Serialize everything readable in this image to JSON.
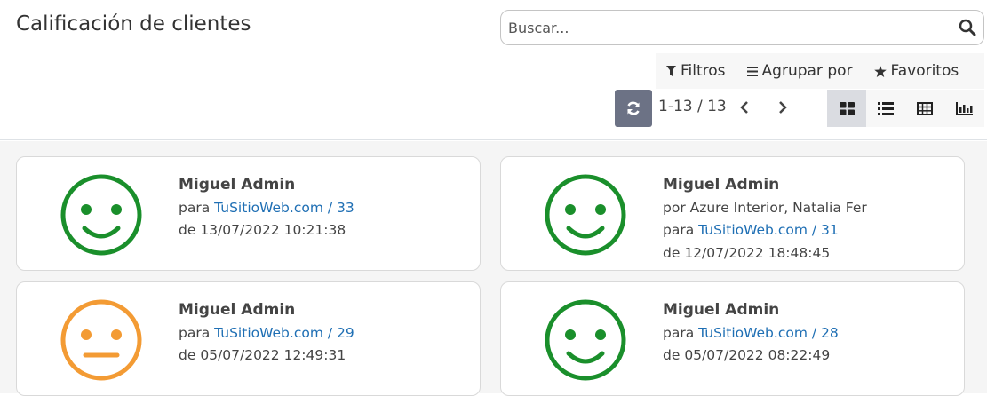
{
  "page": {
    "title": "Calificación de clientes"
  },
  "search": {
    "placeholder": "Buscar..."
  },
  "filters": {
    "filters_label": "Filtros",
    "group_by_label": "Agrupar por",
    "favorites_label": "Favoritos"
  },
  "pager": {
    "value": "1-13 / 13"
  },
  "views": {
    "active": "kanban",
    "items": [
      "kanban-view",
      "list-view",
      "pivot-view",
      "graph-view"
    ]
  },
  "colors": {
    "happy": "#1a8f2b",
    "neutral": "#f39b34",
    "link": "#1f6fb4",
    "refresh": "#6c7285"
  },
  "ratings": [
    {
      "author": "Miguel Admin",
      "by": "",
      "for_prefix": "para",
      "link": "TuSitioWeb.com / 33",
      "date_prefix": "de",
      "date": "13/07/2022 10:21:38",
      "face": "happy-face-icon"
    },
    {
      "author": "Miguel Admin",
      "by": "por Azure Interior, Natalia Fer",
      "for_prefix": "para",
      "link": "TuSitioWeb.com / 31",
      "date_prefix": "de",
      "date": "12/07/2022 18:48:45",
      "face": "happy-face-icon"
    },
    {
      "author": "Miguel Admin",
      "by": "",
      "for_prefix": "para",
      "link": "TuSitioWeb.com / 29",
      "date_prefix": "de",
      "date": "05/07/2022 12:49:31",
      "face": "neutral-face-icon"
    },
    {
      "author": "Miguel Admin",
      "by": "",
      "for_prefix": "para",
      "link": "TuSitioWeb.com / 28",
      "date_prefix": "de",
      "date": "05/07/2022 08:22:49",
      "face": "happy-face-icon"
    }
  ]
}
